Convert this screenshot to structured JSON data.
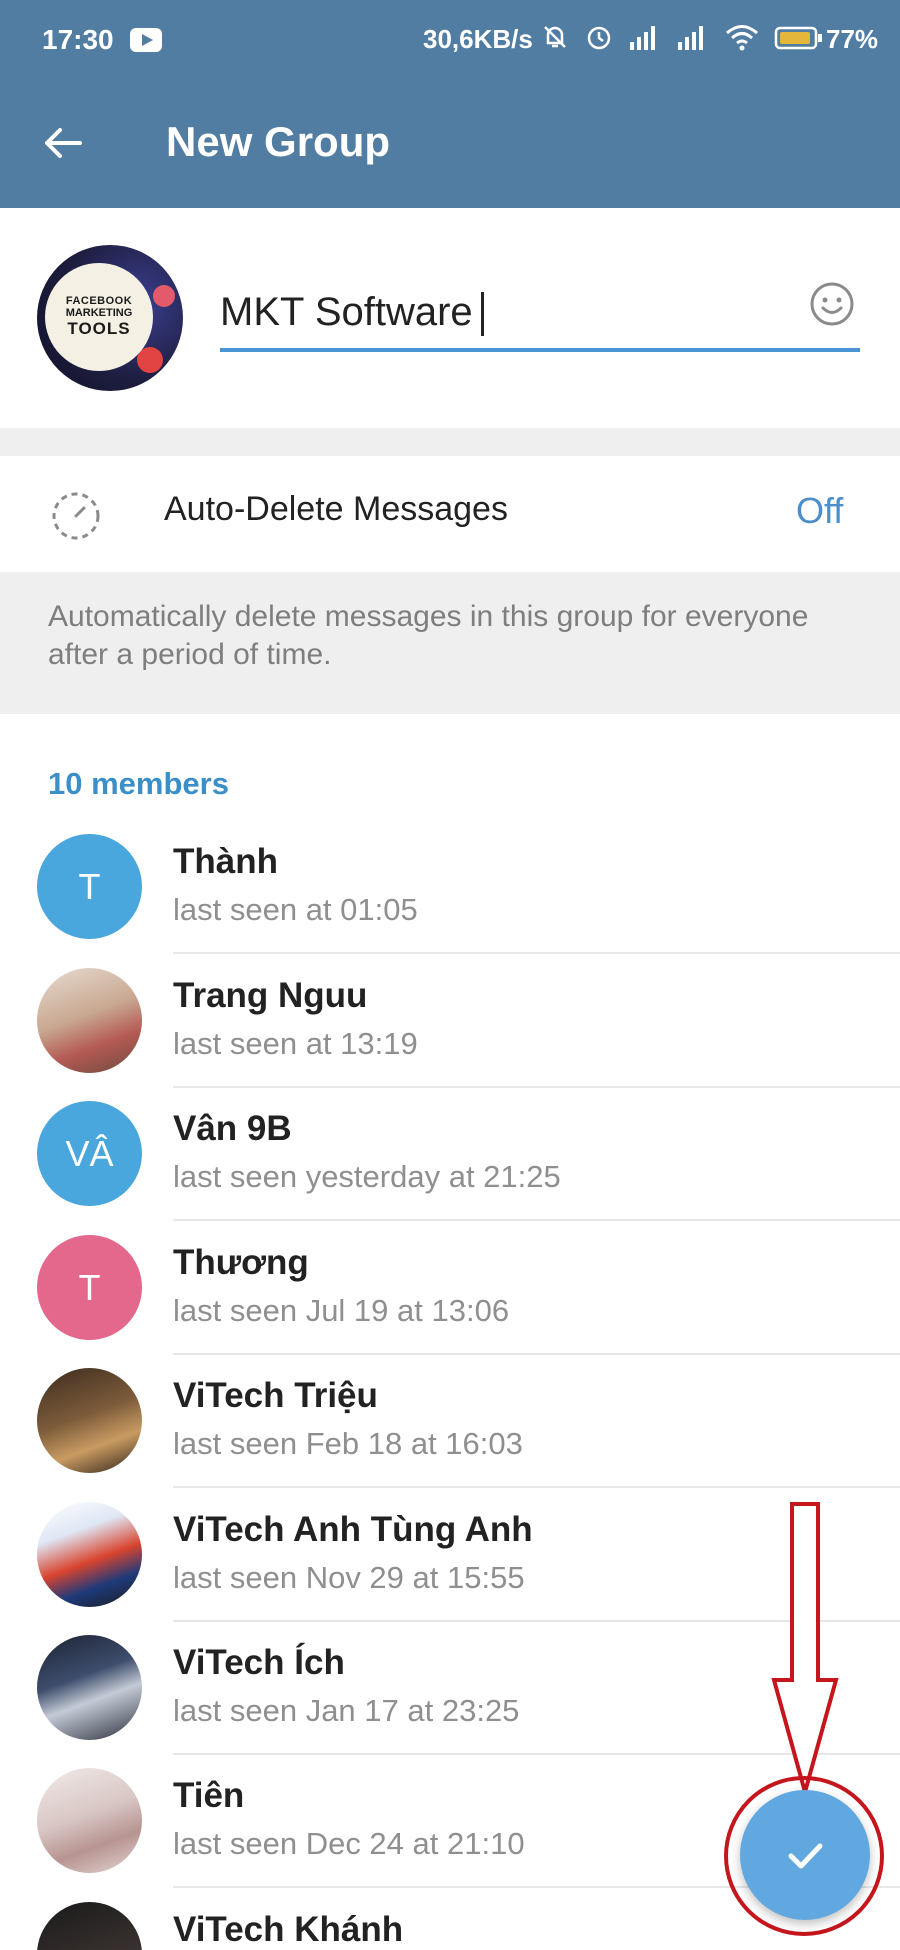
{
  "status_bar": {
    "time": "17:30",
    "network_speed": "30,6KB/s",
    "battery_percent": "77%"
  },
  "header": {
    "title": "New Group"
  },
  "group": {
    "avatar_text": [
      "FACEBOOK",
      "MARKETING",
      "TOOLS"
    ],
    "name_value": "MKT Software"
  },
  "auto_delete": {
    "label": "Auto-Delete Messages",
    "value": "Off",
    "info": "Automatically delete messages in this group for everyone after a period of time."
  },
  "members": {
    "count_label": "10 members",
    "items": [
      {
        "name": "Thành",
        "status": "last seen at 01:05",
        "initials": "T",
        "color": "#4aa7dd"
      },
      {
        "name": "Trang Nguu",
        "status": "last seen at 13:19",
        "initials": "",
        "color": ""
      },
      {
        "name": "Vân 9B",
        "status": "last seen yesterday at 21:25",
        "initials": "VÂ",
        "color": "#4aa7dd"
      },
      {
        "name": "Thương",
        "status": "last seen Jul 19 at 13:06",
        "initials": "T",
        "color": "#e4678c"
      },
      {
        "name": "ViTech Triệu",
        "status": "last seen Feb 18 at 16:03",
        "initials": "",
        "color": ""
      },
      {
        "name": "ViTech Anh Tùng Anh",
        "status": "last seen Nov 29 at 15:55",
        "initials": "",
        "color": ""
      },
      {
        "name": "ViTech Ích",
        "status": "last seen Jan 17 at 23:25",
        "initials": "",
        "color": ""
      },
      {
        "name": "Tiên",
        "status": "last seen Dec 24 at 21:10",
        "initials": "",
        "color": ""
      },
      {
        "name": "ViTech Khánh",
        "status": "",
        "initials": "",
        "color": ""
      }
    ]
  },
  "icons": {
    "back": "arrow-left-icon",
    "emoji": "smiley-icon",
    "timer": "timer-icon",
    "confirm": "checkmark-icon"
  },
  "colors": {
    "header": "#527da3",
    "accent": "#4a8fca",
    "fab": "#62a8e0",
    "annotation": "#c4161c"
  }
}
